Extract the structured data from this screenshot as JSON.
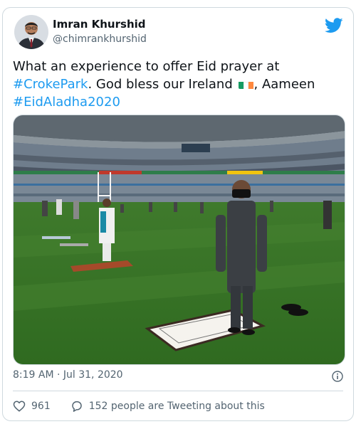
{
  "author": {
    "name": "Imran Khurshid",
    "handle": "@chimrankhurshid"
  },
  "tweet": {
    "text_part1": "What an experience to offer Eid prayer at ",
    "hashtag1": "#CrokePark",
    "text_part2": ". God bless our Ireland ",
    "flag_icon": "ireland-flag-emoji",
    "text_part3": ", Aameen ",
    "hashtag2": "#EidAladha2020"
  },
  "timestamp": "8:19 AM · Jul 31, 2020",
  "actions": {
    "like_count": "961",
    "reply_text": "152 people are Tweeting about this"
  },
  "icons": {
    "brand": "twitter-bird-icon",
    "info": "info-icon",
    "like": "heart-icon",
    "reply": "speech-bubble-icon"
  },
  "colors": {
    "link": "#1d9bf0",
    "text": "#0f1419",
    "muted": "#536471",
    "border": "#cfd9de",
    "flag_green": "#169b62",
    "flag_white": "#ffffff",
    "flag_orange": "#ff883e"
  }
}
